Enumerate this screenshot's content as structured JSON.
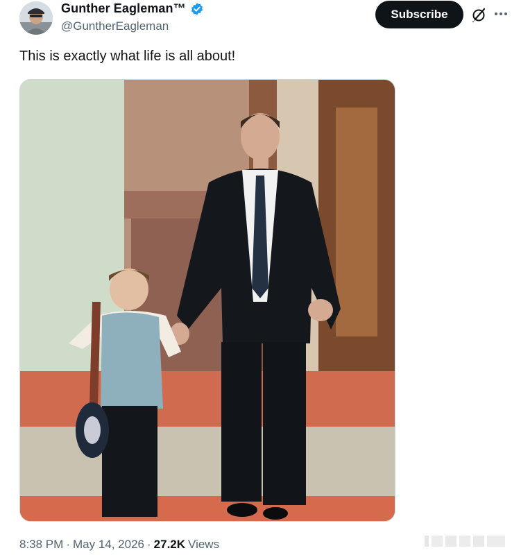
{
  "author": {
    "display_name": "Gunther Eagleman™",
    "handle": "@GuntherEagleman",
    "verified_badge_color": "#1d9bf0"
  },
  "actions": {
    "subscribe_label": "Subscribe",
    "grok_icon": "grok-icon",
    "more_icon": "more-icon"
  },
  "tweet": {
    "text": "This is exactly what life is all about!",
    "media_description": "photo"
  },
  "meta": {
    "time": "8:38 PM",
    "separator1": "·",
    "date": "May 14, 2026",
    "separator2": "·",
    "views_count": "27.2K",
    "views_label": "Views"
  },
  "colors": {
    "text_primary": "#0f1419",
    "text_secondary": "#536471",
    "button_bg": "#0f1419"
  }
}
